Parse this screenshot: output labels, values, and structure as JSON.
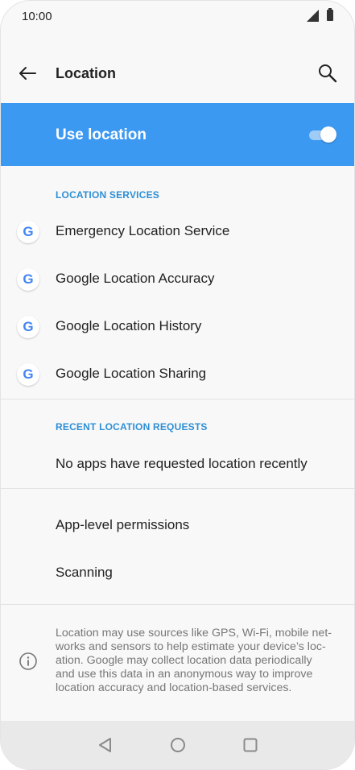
{
  "status": {
    "time": "10:00"
  },
  "appbar": {
    "title": "Location"
  },
  "master": {
    "label": "Use location",
    "enabled": true,
    "accent": "#3c99f2"
  },
  "location_services": {
    "header": "LOCATION SERVICES",
    "items": [
      {
        "label": "Emergency Location Service",
        "icon": "google-g-icon"
      },
      {
        "label": "Google Location Accuracy",
        "icon": "google-g-icon"
      },
      {
        "label": "Google Location History",
        "icon": "google-g-icon"
      },
      {
        "label": "Google Location Sharing",
        "icon": "google-g-icon"
      }
    ]
  },
  "recent_requests": {
    "header": "RECENT LOCATION REQUESTS",
    "empty_text": "No apps have requested location recently"
  },
  "more": {
    "items": [
      {
        "label": "App-level permissions"
      },
      {
        "label": "Scanning"
      }
    ]
  },
  "info": {
    "icon": "info-icon",
    "lines": [
      "Location may use sources like GPS, Wi-Fi, mobile net-",
      "works and sensors to help estimate your device’s loc-",
      "ation. Google may collect location data periodically",
      "and use this data in an anonymous way to improve",
      "location accuracy and location-based services."
    ]
  },
  "nav": {
    "buttons": [
      "back-nav-icon",
      "home-nav-icon",
      "recents-nav-icon"
    ]
  }
}
